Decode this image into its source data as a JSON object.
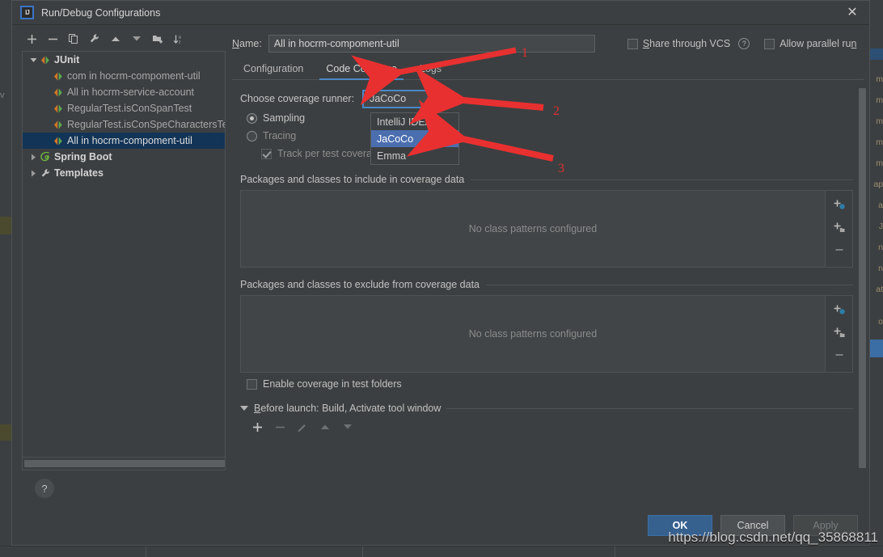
{
  "window": {
    "title": "Run/Debug Configurations",
    "logo_text": "IJ",
    "close_icon": "close-icon"
  },
  "tree_toolbar": [
    {
      "name": "add-configuration-button",
      "icon": "plus-icon"
    },
    {
      "name": "remove-configuration-button",
      "icon": "minus-icon"
    },
    {
      "name": "copy-configuration-button",
      "icon": "copy-icon"
    },
    {
      "name": "edit-templates-button",
      "icon": "wrench-icon"
    },
    {
      "name": "move-up-button",
      "icon": "arrow-up-icon"
    },
    {
      "name": "move-down-button",
      "icon": "arrow-down-icon"
    },
    {
      "name": "move-into-folder-button",
      "icon": "folder-add-icon"
    },
    {
      "name": "sort-configurations-button",
      "icon": "sort-az-icon"
    }
  ],
  "tree": {
    "items": [
      {
        "label": "JUnit",
        "level": 0,
        "type": "group",
        "expanded": true,
        "selected": false,
        "icon": "junit-icon"
      },
      {
        "label": "com in hocrm-compoment-util",
        "level": 1,
        "type": "config",
        "selected": false,
        "icon": "junit-icon"
      },
      {
        "label": "All in hocrm-service-account",
        "level": 1,
        "type": "config",
        "selected": false,
        "icon": "junit-icon"
      },
      {
        "label": "RegularTest.isConSpanTest",
        "level": 1,
        "type": "config",
        "selected": false,
        "icon": "junit-icon"
      },
      {
        "label": "RegularTest.isConSpeCharactersTe",
        "level": 1,
        "type": "config",
        "selected": false,
        "icon": "junit-icon"
      },
      {
        "label": "All in hocrm-compoment-util",
        "level": 1,
        "type": "config",
        "selected": true,
        "icon": "junit-icon"
      },
      {
        "label": "Spring Boot",
        "level": 0,
        "type": "group",
        "expanded": false,
        "selected": false,
        "icon": "spring-boot-icon"
      },
      {
        "label": "Templates",
        "level": 0,
        "type": "group",
        "expanded": false,
        "selected": false,
        "icon": "wrench-icon"
      }
    ]
  },
  "help_button": {
    "label": "?",
    "name": "help-button"
  },
  "name_field": {
    "label": "Name:",
    "label_mnemonic": "N",
    "value": "All in hocrm-compoment-util",
    "placeholder": "Configuration name"
  },
  "top_options": {
    "share_vcs": {
      "label": "Share through VCS",
      "mnemonic": "S",
      "checked": false
    },
    "share_vcs_help": "help-icon",
    "allow_parallel": {
      "label": "Allow parallel run",
      "mnemonic": "n",
      "checked": false
    }
  },
  "tabs": [
    {
      "label": "Configuration",
      "active": false
    },
    {
      "label": "Code Coverage",
      "active": true
    },
    {
      "label": "Logs",
      "active": false
    }
  ],
  "coverage": {
    "runner_label": "Choose coverage runner:",
    "runner_selected": "JaCoCo",
    "runner_options": [
      "IntelliJ IDEA",
      "JaCoCo",
      "Emma"
    ],
    "dropdown_open": true,
    "dropdown_highlighted": "JaCoCo",
    "modes": [
      {
        "label": "Sampling",
        "selected": true,
        "disabled": false
      },
      {
        "label": "Tracing",
        "selected": false,
        "disabled": true
      }
    ],
    "track_per_test": {
      "label": "Track per test coverage",
      "checked": true,
      "disabled": true
    },
    "include_section": {
      "title": "Packages and classes to include in coverage data",
      "empty_text": "No class patterns configured"
    },
    "exclude_section": {
      "title": "Packages and classes to exclude from coverage data",
      "empty_text": "No class patterns configured"
    },
    "panel_tools": [
      {
        "name": "add-class-pattern-button",
        "icon": "plus-class-icon"
      },
      {
        "name": "add-package-pattern-button",
        "icon": "plus-package-icon"
      },
      {
        "name": "remove-pattern-button",
        "icon": "minus-icon"
      }
    ],
    "enable_test_folders": {
      "label": "Enable coverage in test folders",
      "checked": false
    }
  },
  "before_launch": {
    "title": "Before launch: Build, Activate tool window",
    "mnemonic": "B",
    "expanded": true,
    "toolbar": [
      {
        "name": "add-task-button",
        "icon": "plus-icon",
        "disabled": false
      },
      {
        "name": "remove-task-button",
        "icon": "minus-icon",
        "disabled": true
      },
      {
        "name": "edit-task-button",
        "icon": "pencil-icon",
        "disabled": true
      },
      {
        "name": "move-task-up-button",
        "icon": "arrow-up-icon",
        "disabled": true
      },
      {
        "name": "move-task-down-button",
        "icon": "arrow-down-icon",
        "disabled": true
      }
    ]
  },
  "footer": {
    "ok": "OK",
    "cancel": "Cancel",
    "apply": "Apply",
    "apply_disabled": true
  },
  "annotations": [
    {
      "number": "1",
      "target": "code-coverage-tab"
    },
    {
      "number": "2",
      "target": "coverage-runner-combo"
    },
    {
      "number": "3",
      "target": "jacoco-dropdown-item"
    }
  ],
  "watermark": "https://blog.csdn.net/qq_35868811",
  "colors": {
    "dialog_bg": "#3c3f41",
    "accent_blue": "#4a88c7",
    "selection_blue": "#4b6eaf",
    "tree_selection": "#123456",
    "primary_button": "#36618f",
    "annotation_red": "#e03030"
  }
}
